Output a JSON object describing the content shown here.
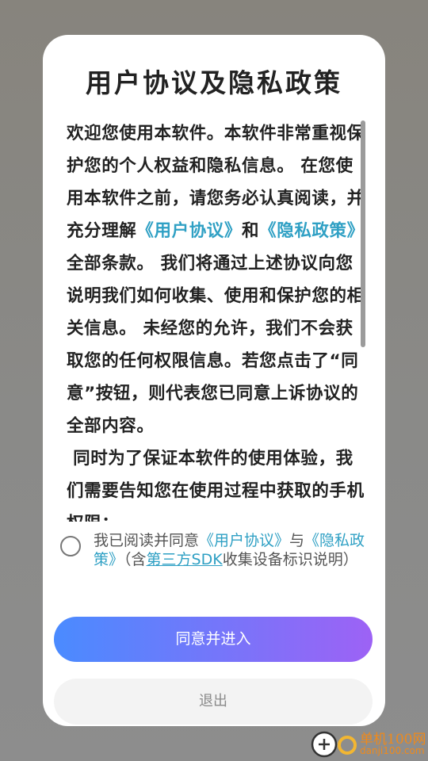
{
  "dialog": {
    "title": "用户协议及隐私政策",
    "body": {
      "p1_a": "欢迎您使用本软件。本软件非常重视保护您的个人权益和隐私信息。 在您使用本软件之前，请您务必认真阅读，并充分理解",
      "link_user_agreement": "《用户协议》",
      "p1_and": "和",
      "link_privacy_policy": "《隐私政策》",
      "p1_b": "全部条款。 我们将通过上述协议向您说明我们如何收集、使用和保护您的相关信息。 未经您的允许，我们不会获取您的任何权限信息。若您点击了“同意”按钮，则代表您已同意上诉协议的全部内容。",
      "p2": " 同时为了保证本软件的使用体验，我们需要告知您在使用过程中获取的手机权限："
    },
    "consent": {
      "prefix": "我已阅读并同意",
      "link_user_agreement": "《用户协议》",
      "and": "与",
      "link_privacy_policy": "《隐私政策》",
      "paren_prefix": "（含",
      "link_sdk": "第三方SDK",
      "suffix": "收集设备标识说明）"
    },
    "agree_button": "同意并进入",
    "exit_button": "退出",
    "colors": {
      "link": "#2fa0c4",
      "button_gradient_start": "#4a8bff",
      "button_gradient_end": "#9d62f5"
    }
  },
  "watermark": {
    "site_name": "单机100网",
    "url": "danji100.com"
  }
}
